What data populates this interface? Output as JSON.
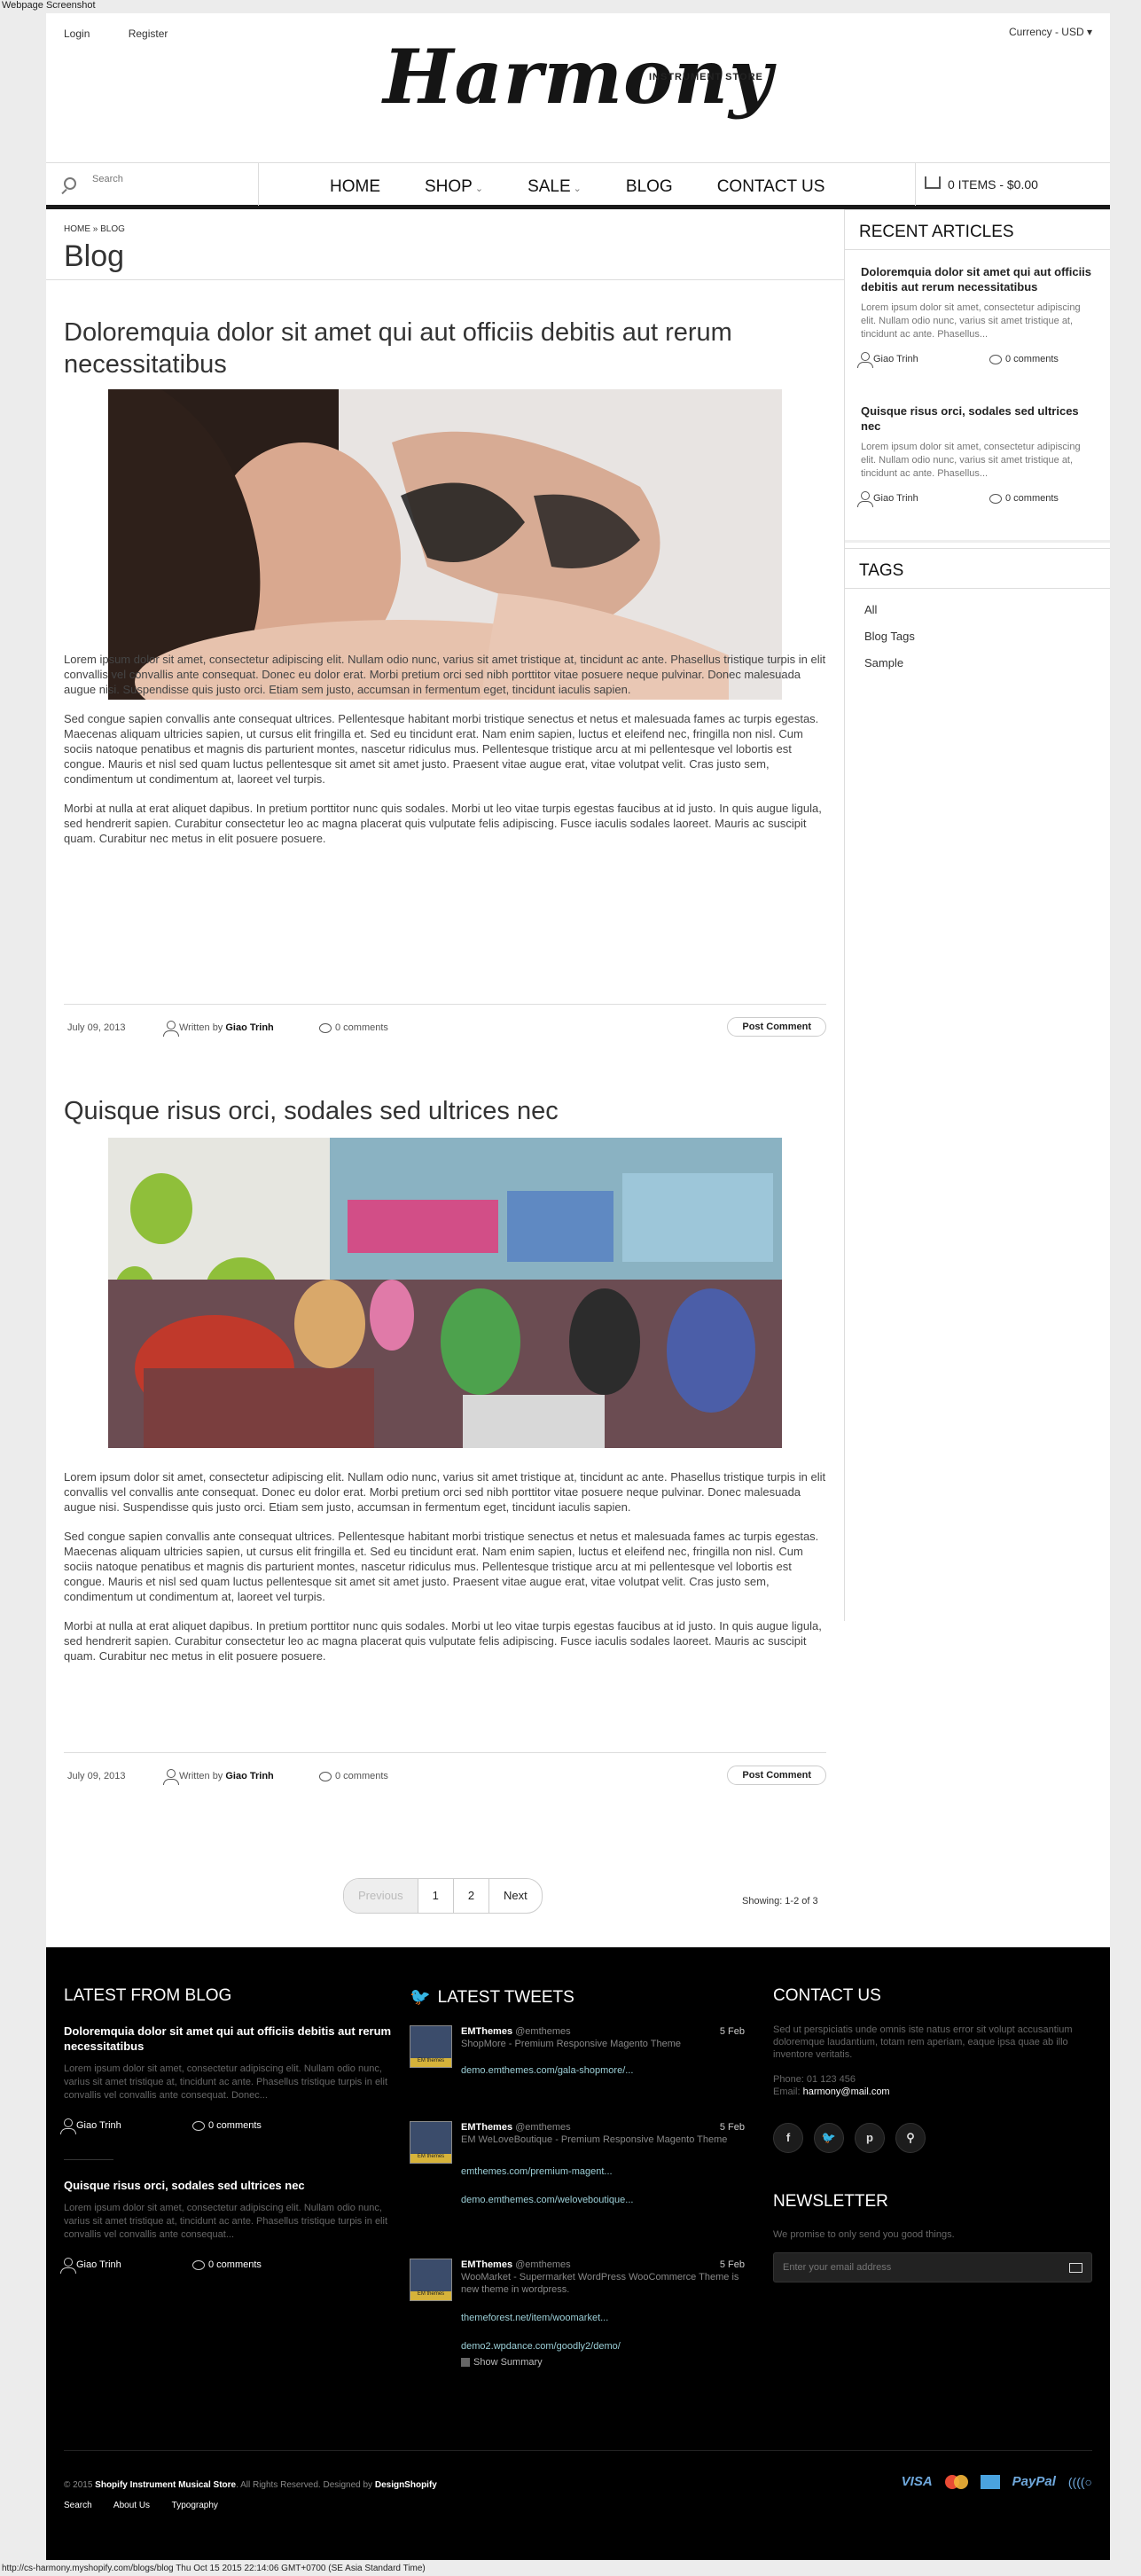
{
  "window": {
    "label": "Webpage Screenshot"
  },
  "status_bar": {
    "text": "http://cs-harmony.myshopify.com/blogs/blog Thu Oct 15 2015 22:14:06 GMT+0700 (SE Asia Standard Time)"
  },
  "top": {
    "login": "Login",
    "register": "Register",
    "currency": "Currency -  USD  ▾"
  },
  "logo": {
    "word": "Harmony",
    "sub": "INSTRUMENT STORE"
  },
  "nav": {
    "search_placeholder": "Search",
    "items": [
      {
        "label": "HOME"
      },
      {
        "label": "SHOP"
      },
      {
        "label": "SALE"
      },
      {
        "label": "BLOG"
      },
      {
        "label": "CONTACT US"
      }
    ],
    "cart": "0 ITEMS - $0.00"
  },
  "breadcrumb": "HOME » BLOG",
  "page_title": "Blog",
  "posts": [
    {
      "title": "Doloremquia dolor sit amet qui aut officiis debitis aut rerum necessitatibus",
      "p1": "Lorem ipsum dolor sit amet, consectetur adipiscing elit. Nullam odio nunc, varius sit amet tristique at, tincidunt ac ante. Phasellus tristique turpis in elit convallis vel convallis ante consequat. Donec eu dolor erat. Morbi pretium orci sed nibh porttitor vitae posuere neque pulvinar. Donec malesuada augue nisi. Suspendisse quis justo orci. Etiam sem justo, accumsan in fermentum eget, tincidunt iaculis sapien.",
      "p2": "Sed congue sapien convallis ante consequat ultrices. Pellentesque habitant morbi tristique senectus et netus et malesuada fames ac turpis egestas. Maecenas aliquam ultricies sapien, ut cursus elit fringilla et. Sed eu tincidunt erat. Nam enim sapien, luctus et eleifend nec, fringilla non nisl. Cum sociis natoque penatibus et magnis dis parturient montes, nascetur ridiculus mus. Pellentesque tristique arcu at mi pellentesque vel lobortis est congue. Mauris et nisl sed quam luctus pellentesque sit amet sit amet justo. Praesent vitae augue erat, vitae volutpat velit. Cras justo sem, condimentum ut condimentum at, laoreet vel turpis.",
      "p3": "Morbi at nulla at erat aliquet dapibus. In pretium porttitor nunc quis sodales. Morbi ut leo vitae turpis egestas faucibus at id justo. In quis augue ligula, sed hendrerit sapien. Curabitur consectetur leo ac magna placerat quis vulputate felis adipiscing. Fusce iaculis sodales laoreet. Mauris ac suscipit quam. Curabitur nec metus in elit posuere posuere.",
      "date": "July 09, 2013",
      "written_by": "Written by ",
      "author": "Giao Trinh",
      "comments": "0 comments",
      "button": "Post Comment"
    },
    {
      "title": "Quisque risus orci, sodales sed ultrices nec",
      "p1": "Lorem ipsum dolor sit amet, consectetur adipiscing elit. Nullam odio nunc, varius sit amet tristique at, tincidunt ac ante. Phasellus tristique turpis in elit convallis vel convallis ante consequat. Donec eu dolor erat. Morbi pretium orci sed nibh porttitor vitae posuere neque pulvinar. Donec malesuada augue nisi. Suspendisse quis justo orci. Etiam sem justo, accumsan in fermentum eget, tincidunt iaculis sapien.",
      "p2": "Sed congue sapien convallis ante consequat ultrices. Pellentesque habitant morbi tristique senectus et netus et malesuada fames ac turpis egestas. Maecenas aliquam ultricies sapien, ut cursus elit fringilla et. Sed eu tincidunt erat. Nam enim sapien, luctus et eleifend nec, fringilla non nisl. Cum sociis natoque penatibus et magnis dis parturient montes, nascetur ridiculus mus. Pellentesque tristique arcu at mi pellentesque vel lobortis est congue. Mauris et nisl sed quam luctus pellentesque sit amet sit amet justo. Praesent vitae augue erat, vitae volutpat velit. Cras justo sem, condimentum ut condimentum at, laoreet vel turpis.",
      "p3": "Morbi at nulla at erat aliquet dapibus. In pretium porttitor nunc quis sodales. Morbi ut leo vitae turpis egestas faucibus at id justo. In quis augue ligula, sed hendrerit sapien. Curabitur consectetur leo ac magna placerat quis vulputate felis adipiscing. Fusce iaculis sodales laoreet. Mauris ac suscipit quam. Curabitur nec metus in elit posuere posuere.",
      "date": "July 09, 2013",
      "written_by": "Written by ",
      "author": "Giao Trinh",
      "comments": "0 comments",
      "button": "Post Comment"
    }
  ],
  "pagination": {
    "prev": "Previous",
    "p1": "1",
    "p2": "2",
    "next": "Next",
    "showing": "Showing: 1-2 of 3"
  },
  "sidebar": {
    "recent_head": "RECENT ARTICLES",
    "recent": [
      {
        "title": "Doloremquia dolor sit amet qui aut officiis debitis aut rerum necessitatibus",
        "text": "Lorem ipsum dolor sit amet, consectetur adipiscing elit. Nullam odio nunc, varius sit amet tristique at, tincidunt ac ante. Phasellus...",
        "author": "Giao Trinh",
        "comments": "0 comments"
      },
      {
        "title": "Quisque risus orci, sodales sed ultrices nec",
        "text": "  Lorem ipsum dolor sit amet, consectetur adipiscing elit. Nullam odio nunc, varius sit amet tristique at, tincidunt ac ante. Phasellus...",
        "author": "Giao Trinh",
        "comments": "0 comments"
      }
    ],
    "tags_head": "TAGS",
    "tags": [
      "All",
      "Blog Tags",
      "Sample"
    ]
  },
  "footer": {
    "blog_head": "LATEST FROM BLOG",
    "blog": [
      {
        "title": "Doloremquia dolor sit amet qui aut officiis debitis aut rerum necessitatibus",
        "text": "Lorem ipsum dolor sit amet, consectetur adipiscing elit. Nullam odio nunc, varius sit amet tristique at, tincidunt ac ante. Phasellus tristique turpis in elit convallis vel convallis ante consequat. Donec...",
        "author": "Giao Trinh",
        "comments": "0 comments"
      },
      {
        "title": "Quisque risus orci, sodales sed ultrices nec",
        "text": "  Lorem ipsum dolor sit amet, consectetur adipiscing elit. Nullam odio nunc, varius sit amet tristique at, tincidunt ac ante. Phasellus tristique turpis in elit convallis vel convallis ante consequat...",
        "author": "Giao Trinh",
        "comments": "0 comments"
      }
    ],
    "tweets_head": "LATEST TWEETS",
    "tweets": [
      {
        "name": "EMThemes",
        "handle": "@emthemes",
        "date": "5 Feb",
        "text": "ShopMore - Premium Responsive Magento Theme",
        "links": [
          "demo.emthemes.com/gala-shopmore/..."
        ]
      },
      {
        "name": "EMThemes",
        "handle": "@emthemes",
        "date": "5 Feb",
        "text": "EM WeLoveBoutique - Premium Responsive Magento Theme",
        "links": [
          "emthemes.com/premium-magent...",
          "demo.emthemes.com/weloveboutique..."
        ]
      },
      {
        "name": "EMThemes",
        "handle": "@emthemes",
        "date": "5 Feb",
        "text": "WooMarket - Supermarket WordPress WooCommerce Theme is new theme in wordpress.",
        "links": [
          "themeforest.net/item/woomarket...",
          "demo2.wpdance.com/goodly2/demo/"
        ]
      }
    ],
    "avatar_label": "EM themes",
    "show_summary": "Show Summary",
    "contact_head": "CONTACT US",
    "contact_text": "Sed ut perspiciatis unde omnis iste natus error sit volupt accusantium doloremque laudantium, totam rem aperiam, eaque ipsa quae ab illo inventore veritatis.",
    "phone": "Phone: 01 123 456",
    "email_label": "Email: ",
    "email": "harmony@mail.com",
    "social": [
      "f",
      "t",
      "p",
      "rss"
    ],
    "news_head": "NEWSLETTER",
    "news_text": "We promise to only send you good things.",
    "news_placeholder": "Enter your email address",
    "copyright_pre": "© 2015 ",
    "copyright_store": "Shopify Instrument Musical Store",
    "copyright_mid": ". All Rights Reserved. Designed by ",
    "copyright_by": "DesignShopify",
    "links": [
      "Search",
      "About Us",
      "Typography"
    ],
    "payments": [
      "VISA",
      "PayPal"
    ]
  }
}
